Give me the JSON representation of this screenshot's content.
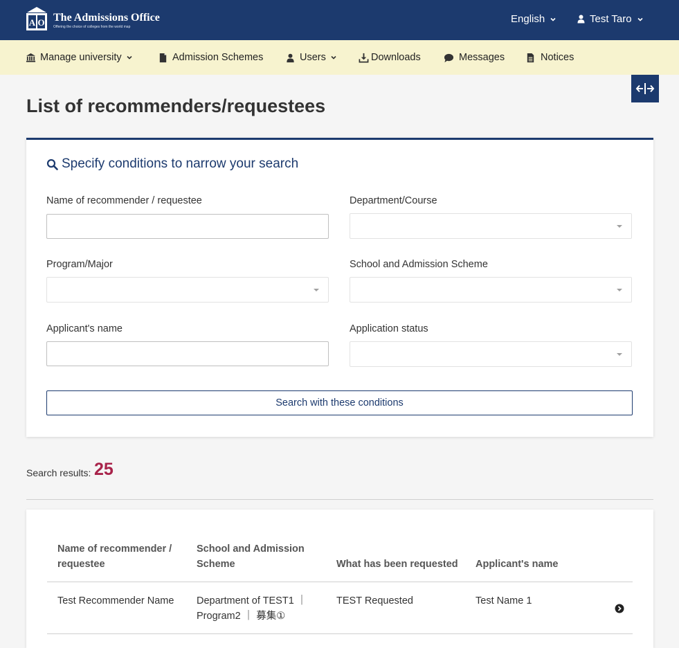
{
  "header": {
    "logo_letters": "AO",
    "logo_title": "The Admissions Office",
    "logo_subtitle": "Offering the choice of colleges from the world map",
    "language": "English",
    "user_name": "Test Taro"
  },
  "nav": {
    "items": [
      {
        "label": "Manage university",
        "icon": "university-icon",
        "dropdown": true
      },
      {
        "label": "Admission Schemes",
        "icon": "file-icon",
        "dropdown": false
      },
      {
        "label": "Users",
        "icon": "user-icon",
        "dropdown": true
      },
      {
        "label": "Downloads",
        "icon": "download-icon",
        "dropdown": false
      },
      {
        "label": "Messages",
        "icon": "comment-icon",
        "dropdown": false
      },
      {
        "label": "Notices",
        "icon": "document-icon",
        "dropdown": false
      }
    ]
  },
  "page": {
    "title": "List of recommenders/requestees"
  },
  "search": {
    "heading": "Specify conditions to narrow your search",
    "fields": {
      "recommender_name": {
        "label": "Name of recommender / requestee",
        "value": "",
        "placeholder": ""
      },
      "department": {
        "label": "Department/Course",
        "value": ""
      },
      "program": {
        "label": "Program/Major",
        "value": ""
      },
      "school_scheme": {
        "label": "School and Admission Scheme",
        "value": ""
      },
      "applicant_name": {
        "label": "Applicant's name",
        "value": "",
        "placeholder": ""
      },
      "application_status": {
        "label": "Application status",
        "value": ""
      }
    },
    "submit_label": "Search with these conditions"
  },
  "results": {
    "label": "Search results:",
    "count": "25",
    "columns": [
      "Name of recommender / requestee",
      "School and Admission Scheme",
      "What has been requested",
      "Applicant's name"
    ],
    "rows": [
      {
        "recommender": "Test Recommender Name",
        "scheme": "Department of TEST1 ｜ Program2 ｜ 募集①",
        "requested": "TEST Requested",
        "applicant": "Test Name 1"
      }
    ]
  },
  "colors": {
    "brand_navy": "#1c3a6e",
    "nav_background": "#f7f3cf",
    "count_accent": "#a8234a"
  }
}
